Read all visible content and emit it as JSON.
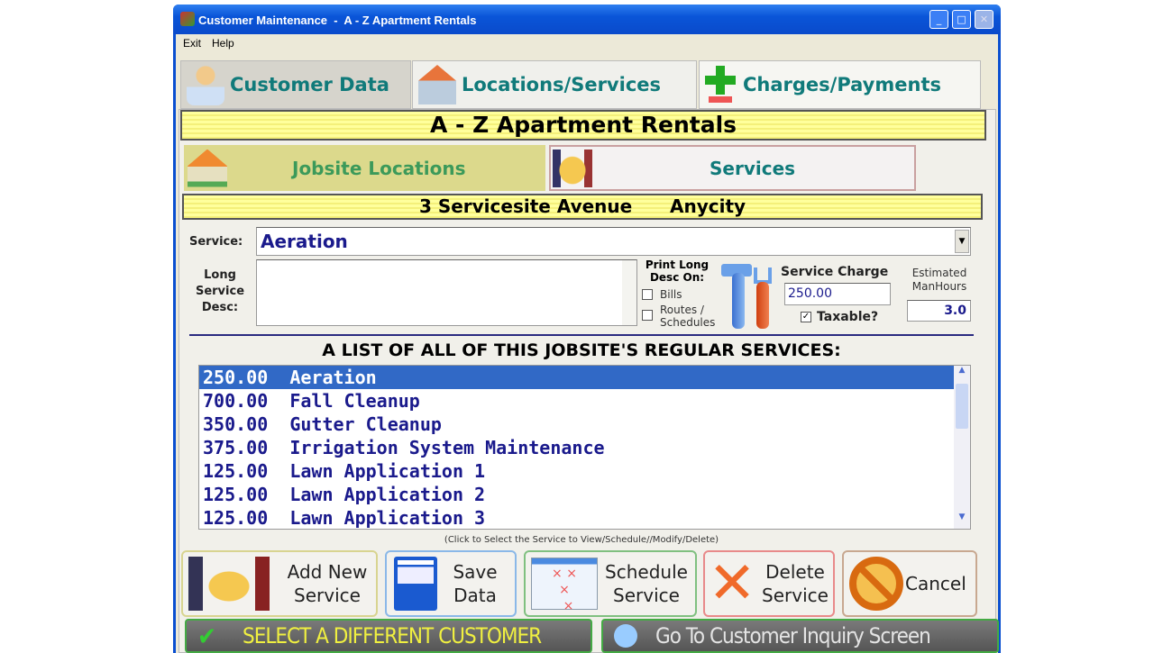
{
  "window": {
    "title": "Customer Maintenance  -  A - Z Apartment Rentals"
  },
  "menu": [
    {
      "label": "Exit"
    },
    {
      "label": "Help"
    }
  ],
  "tabs": [
    {
      "label": "Customer Data",
      "icon": "person-icon"
    },
    {
      "label": "Locations/Services",
      "icon": "house-handshake-icon",
      "active": true
    },
    {
      "label": "Charges/Payments",
      "icon": "plus-minus-icon"
    }
  ],
  "customer_name": "A - Z Apartment Rentals",
  "subtabs": [
    {
      "label": "Jobsite Locations",
      "icon": "house-icon"
    },
    {
      "label": "Services",
      "icon": "handshake-icon",
      "active": true
    }
  ],
  "address": {
    "street": "3 Servicesite Avenue",
    "city": "Anycity"
  },
  "form": {
    "service_label": "Service:",
    "service_value": "Aeration",
    "long_desc_label": "Long Service Desc:",
    "long_desc_value": "",
    "print_label": "Print Long Desc On:",
    "bills_label": "Bills",
    "bills_checked": false,
    "routes_label": "Routes / Schedules",
    "routes_checked": false,
    "charge_label": "Service Charge",
    "charge_value": "250.00",
    "taxable_label": "Taxable?",
    "taxable_checked": true,
    "hours_label": "Estimated ManHours",
    "hours_value": "3.0"
  },
  "list": {
    "title": "A LIST OF ALL OF THIS JOBSITE'S REGULAR SERVICES:",
    "items": [
      {
        "amount": "250.00",
        "name": "Aeration",
        "selected": true
      },
      {
        "amount": "700.00",
        "name": "Fall Cleanup"
      },
      {
        "amount": "350.00",
        "name": "Gutter Cleanup"
      },
      {
        "amount": "375.00",
        "name": "Irrigation System Maintenance"
      },
      {
        "amount": "125.00",
        "name": "Lawn Application 1"
      },
      {
        "amount": "125.00",
        "name": "Lawn Application 2"
      },
      {
        "amount": "125.00",
        "name": "Lawn Application 3"
      }
    ],
    "hint": "(Click to Select the Service to View/Schedule//Modify/Delete)"
  },
  "buttons": {
    "add": "Add New Service",
    "save": "Save Data",
    "schedule": "Schedule Service",
    "delete": "Delete Service",
    "cancel": "Cancel"
  },
  "bottom": {
    "select_customer": "SELECT A DIFFERENT CUSTOMER",
    "inquiry": "Go To Customer Inquiry Screen"
  },
  "colors": {
    "title_bar": "#0a55d8",
    "tab_text": "#107a7a",
    "list_text": "#1a1a8c",
    "selection": "#3169c6",
    "banner": "#ffff9c"
  }
}
